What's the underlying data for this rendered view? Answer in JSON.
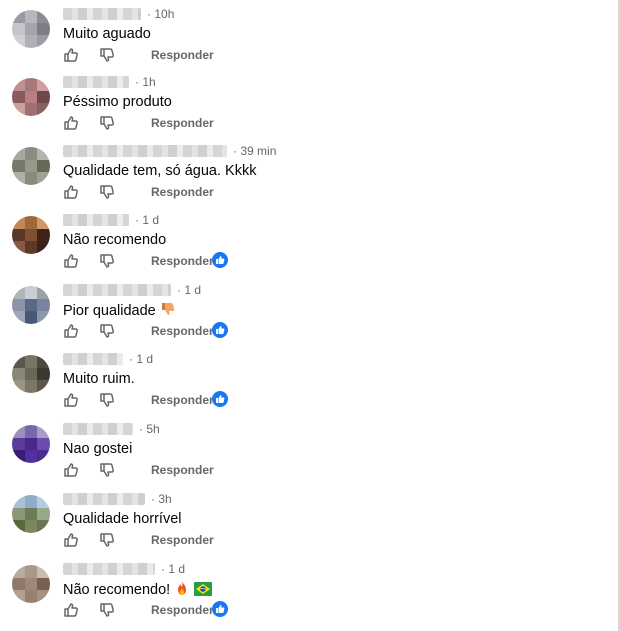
{
  "reply_label": "Responder",
  "like_badge_color": "#1877f2",
  "comments": [
    {
      "time": "10h",
      "text": "Muito aguado",
      "emoji": [],
      "reactions": false,
      "avatar": [
        "#9a9aa6",
        "#b6b6be",
        "#8c8c96",
        "#c4c4cc",
        "#a4a4ac",
        "#7e7e88",
        "#d0d0d6",
        "#b0b0b8",
        "#9c9ca6"
      ]
    },
    {
      "time": "1h",
      "text": "Péssimo produto",
      "emoji": [],
      "reactions": false,
      "avatar": [
        "#c09090",
        "#a87878",
        "#d0a0a0",
        "#8a5a5a",
        "#b88080",
        "#704848",
        "#c8a0a0",
        "#a07070",
        "#886060"
      ]
    },
    {
      "time": "39 min",
      "text": "Qualidade tem, só água. Kkkk",
      "emoji": [],
      "reactions": false,
      "avatar": [
        "#a8a8a0",
        "#8c8c80",
        "#b4b4ac",
        "#787868",
        "#989888",
        "#686858",
        "#b0b0a8",
        "#8a8a7c",
        "#a0a094"
      ]
    },
    {
      "time": "1 d",
      "text": "Não recomendo",
      "emoji": [],
      "reactions": true,
      "avatar": [
        "#c08858",
        "#a06838",
        "#d09868",
        "#5a3828",
        "#805030",
        "#402418",
        "#8a5a40",
        "#603828",
        "#3a2418"
      ]
    },
    {
      "time": "1 d",
      "text": "Pior qualidade",
      "emoji": [
        "thumbs-down"
      ],
      "reactions": true,
      "avatar": [
        "#b0b4bc",
        "#c8ccd4",
        "#9ca0a8",
        "#8a94a8",
        "#5a6888",
        "#7884a0",
        "#a0a8b8",
        "#4a5878",
        "#8c98b0"
      ]
    },
    {
      "time": "1 d",
      "text": "Muito ruim.",
      "emoji": [],
      "reactions": true,
      "avatar": [
        "#5a5850",
        "#787468",
        "#4a4840",
        "#8a8678",
        "#6a6658",
        "#3a3830",
        "#9a9484",
        "#7a7668",
        "#5a5648"
      ]
    },
    {
      "time": "5h",
      "text": "Nao gostei",
      "emoji": [],
      "reactions": false,
      "avatar": [
        "#9a90c0",
        "#7868a8",
        "#a89ccc",
        "#5a3c9a",
        "#4a2888",
        "#6a4cac",
        "#3a1c78",
        "#5030a0",
        "#4a2c90"
      ]
    },
    {
      "time": "3h",
      "text": "Qualidade horrível",
      "emoji": [],
      "reactions": false,
      "avatar": [
        "#a8c0d8",
        "#90acc8",
        "#b8cce0",
        "#8a9878",
        "#6a7c58",
        "#98a888",
        "#5a6840",
        "#7a8860",
        "#6a7450"
      ]
    },
    {
      "time": "1 d",
      "text": "Não recomendo!",
      "emoji": [
        "fire",
        "brazil-flag"
      ],
      "reactions": true,
      "avatar": [
        "#b8aca0",
        "#a89888",
        "#c8bcb0",
        "#907868",
        "#a08878",
        "#786050",
        "#b0a090",
        "#988070",
        "#a89080"
      ]
    }
  ]
}
